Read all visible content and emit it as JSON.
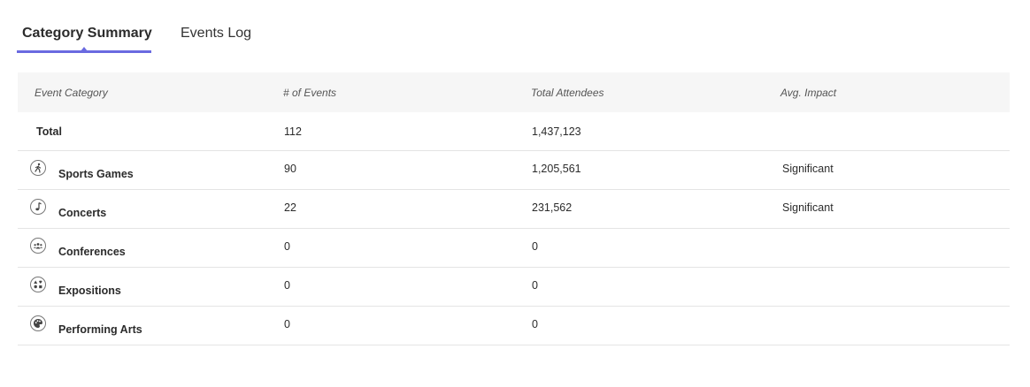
{
  "tabs": [
    {
      "label": "Category Summary",
      "active": true
    },
    {
      "label": "Events Log",
      "active": false
    }
  ],
  "table": {
    "headers": {
      "category": "Event Category",
      "events": "# of Events",
      "attendees": "Total Attendees",
      "impact": "Avg. Impact"
    },
    "total": {
      "label": "Total",
      "events": "112",
      "attendees": "1,437,123",
      "impact": ""
    },
    "rows": [
      {
        "icon": "person-walking-icon",
        "category": "Sports Games",
        "events": "90",
        "attendees": "1,205,561",
        "impact": "Significant"
      },
      {
        "icon": "music-note-icon",
        "category": "Concerts",
        "events": "22",
        "attendees": "231,562",
        "impact": "Significant"
      },
      {
        "icon": "group-people-icon",
        "category": "Conferences",
        "events": "0",
        "attendees": "0",
        "impact": ""
      },
      {
        "icon": "shapes-icon",
        "category": "Expositions",
        "events": "0",
        "attendees": "0",
        "impact": ""
      },
      {
        "icon": "palette-icon",
        "category": "Performing Arts",
        "events": "0",
        "attendees": "0",
        "impact": ""
      }
    ]
  },
  "colors": {
    "accent": "#6a6ae0",
    "header_bg": "#f6f6f6",
    "divider": "#e4e4e4"
  }
}
